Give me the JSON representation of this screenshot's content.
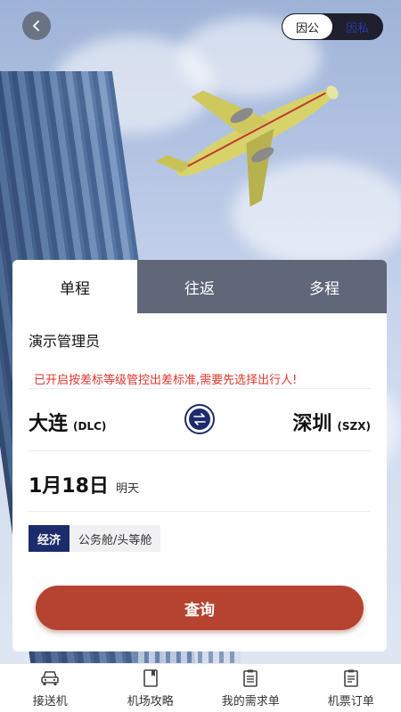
{
  "header": {
    "toggle_options": [
      "因公",
      "因私"
    ],
    "toggle_selected": "因公"
  },
  "tabs": [
    {
      "label": "单程",
      "active": true
    },
    {
      "label": "往返",
      "active": false
    },
    {
      "label": "多程",
      "active": false
    }
  ],
  "form": {
    "passenger": "演示管理员",
    "warning": "已开启按差标等级管控出差标准,需要先选择出行人!",
    "from_city": "大连",
    "from_code": "(DLC)",
    "to_city": "深圳",
    "to_code": "(SZX)",
    "date": "1月18日",
    "date_note": "明天",
    "cabins": [
      {
        "label": "经济",
        "active": true
      },
      {
        "label": "公务舱/头等舱",
        "active": false
      }
    ],
    "search_label": "查询"
  },
  "bottom_nav": [
    {
      "label": "接送机",
      "icon": "car-icon"
    },
    {
      "label": "机场攻略",
      "icon": "book-icon"
    },
    {
      "label": "我的需求单",
      "icon": "clipboard-icon"
    },
    {
      "label": "机票订单",
      "icon": "order-icon"
    }
  ],
  "colors": {
    "brand": "#1c2b6b",
    "accent": "#b5432f",
    "warning": "#e0362c"
  }
}
